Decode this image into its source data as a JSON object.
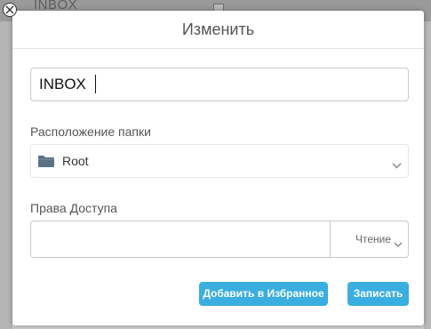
{
  "background": {
    "title": "INBOX"
  },
  "dialog": {
    "title": "Изменить",
    "name_value": "INBOX",
    "folder_location_label": "Расположение папки",
    "folder_location_value": "Root",
    "access_rights_label": "Права Доступа",
    "access_rights_input_value": "",
    "access_level_value": "Чтение",
    "add_to_favorites_label": "Добавить в Избранное",
    "save_label": "Записать"
  },
  "colors": {
    "accent": "#3aaee0",
    "folder_icon": "#5b6f86"
  },
  "icons": {
    "close": "close-icon",
    "folder": "folder-icon",
    "chevron": "chevron-down-icon"
  }
}
